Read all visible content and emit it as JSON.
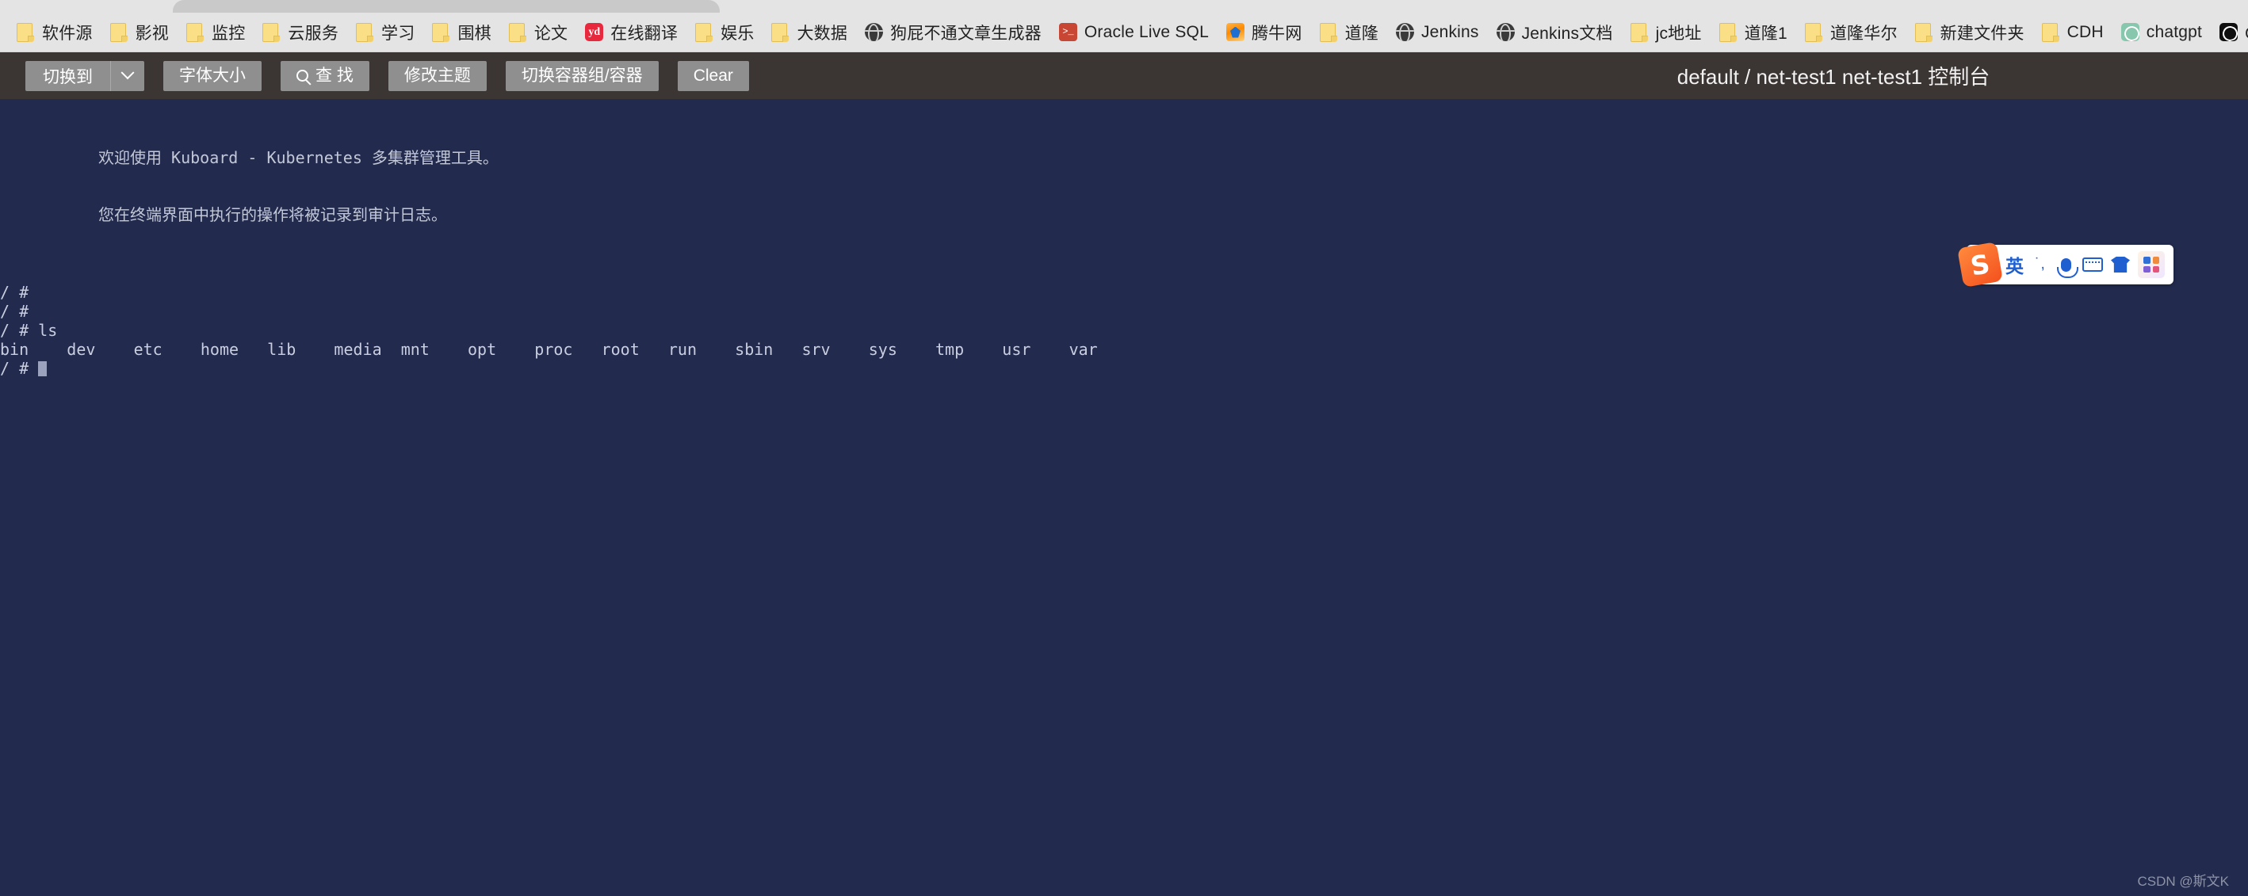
{
  "browser": {
    "bookmarks": [
      {
        "label": "软件源",
        "icon": "folder-icon"
      },
      {
        "label": "影视",
        "icon": "folder-icon"
      },
      {
        "label": "监控",
        "icon": "folder-icon"
      },
      {
        "label": "云服务",
        "icon": "folder-icon"
      },
      {
        "label": "学习",
        "icon": "folder-icon"
      },
      {
        "label": "围棋",
        "icon": "folder-icon"
      },
      {
        "label": "论文",
        "icon": "folder-icon"
      },
      {
        "label": "在线翻译",
        "icon": "youdao-icon"
      },
      {
        "label": "娱乐",
        "icon": "folder-icon"
      },
      {
        "label": "大数据",
        "icon": "folder-icon"
      },
      {
        "label": "狗屁不通文章生成器",
        "icon": "globe-icon"
      },
      {
        "label": "Oracle Live SQL",
        "icon": "terminal-icon"
      },
      {
        "label": "腾牛网",
        "icon": "tengniu-icon"
      },
      {
        "label": "道隆",
        "icon": "folder-icon"
      },
      {
        "label": "Jenkins",
        "icon": "globe-icon"
      },
      {
        "label": "Jenkins文档",
        "icon": "globe-icon"
      },
      {
        "label": "jc地址",
        "icon": "folder-icon"
      },
      {
        "label": "道隆1",
        "icon": "folder-icon"
      },
      {
        "label": "道隆华尔",
        "icon": "folder-icon"
      },
      {
        "label": "新建文件夹",
        "icon": "folder-icon"
      },
      {
        "label": "CDH",
        "icon": "folder-icon"
      },
      {
        "label": "chatgpt",
        "icon": "chatgpt-icon"
      },
      {
        "label": "OPENAI-非",
        "icon": "chatgpt-dark-icon"
      }
    ]
  },
  "toolbar": {
    "switch_to_label": "切换到",
    "font_size_label": "字体大小",
    "search_label": "查 找",
    "theme_label": "修改主题",
    "switch_container_label": "切换容器组/容器",
    "clear_label": "Clear",
    "title": "default / net-test1 net-test1 控制台"
  },
  "terminal": {
    "banner_line1": "欢迎使用 Kuboard - Kubernetes 多集群管理工具。",
    "banner_line2": "您在终端界面中执行的操作将被记录到审计日志。",
    "lines": [
      "/ #",
      "/ #",
      "/ # ls",
      "bin    dev    etc    home   lib    media  mnt    opt    proc   root   run    sbin   srv    sys    tmp    usr    var"
    ],
    "prompt": "/ # ",
    "watermark": "CSDN @斯文K"
  },
  "ime": {
    "logo": "S",
    "mode_label": "英",
    "punctuation_label": "˙,",
    "voice_label": "voice-input-icon",
    "keyboard_label": "soft-keyboard-icon",
    "skin_label": "skin-icon",
    "apps_label": "toolbox-icon"
  },
  "colors": {
    "terminal_bg": "#222a4d",
    "toolbar_bg": "#3b3533",
    "button_bg": "#8f8f8f",
    "bookmark_bg": "#e4e4e4",
    "ime_accent": "#1f5fd0"
  }
}
